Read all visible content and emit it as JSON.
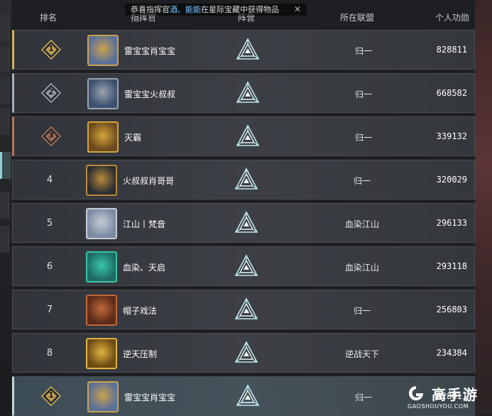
{
  "header": {
    "rank": "排名",
    "commander": "指挥官",
    "camp": "阵营",
    "alliance": "所在联盟",
    "merit": "个人功勋"
  },
  "notice": {
    "prefix": "恭喜指挥官",
    "highlight": "酒、能能",
    "suffix": "在星际宝藏中获得物品",
    "close": "✕"
  },
  "rows": [
    {
      "rank": "1",
      "name": "雷宝宝肖宝宝",
      "alliance": "归一",
      "merit": "828811"
    },
    {
      "rank": "2",
      "name": "雷宝宝火叔叔",
      "alliance": "归一",
      "merit": "668582"
    },
    {
      "rank": "3",
      "name": "灭霸",
      "alliance": "归一",
      "merit": "339132"
    },
    {
      "rank": "4",
      "name": "火叔叔肖哥哥",
      "alliance": "归一",
      "merit": "320029"
    },
    {
      "rank": "5",
      "name": "江山丨梵音",
      "alliance": "血染江山",
      "merit": "296133"
    },
    {
      "rank": "6",
      "name": "血染、天启",
      "alliance": "血染江山",
      "merit": "293118"
    },
    {
      "rank": "7",
      "name": "帽子戏法",
      "alliance": "归一",
      "merit": "256803"
    },
    {
      "rank": "8",
      "name": "逆天压制",
      "alliance": "逆战天下",
      "merit": "234384"
    },
    {
      "rank": "1",
      "name": "雷宝宝肖宝宝",
      "alliance": "归一",
      "merit": "828811"
    }
  ],
  "watermark": {
    "brand": "高手游",
    "url": "GAOSHOUYOU.COM"
  },
  "colors": {
    "gold": "#d7b459",
    "silver": "#a9b0ba",
    "bronze": "#b7795a"
  }
}
